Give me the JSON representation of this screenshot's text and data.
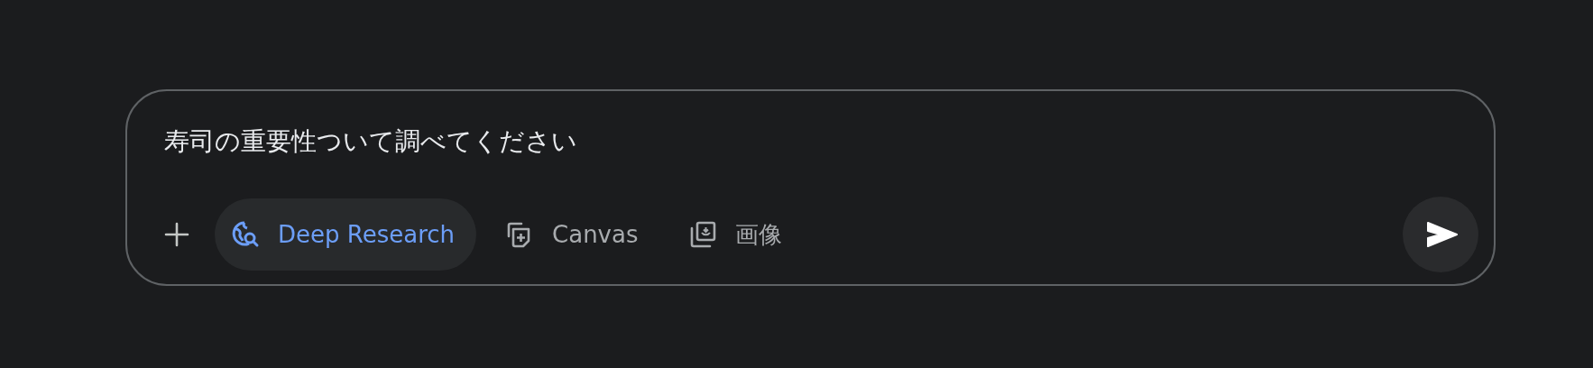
{
  "prompt": {
    "value": "寿司の重要性ついて調べてください"
  },
  "tools": [
    {
      "kind": "deep-research",
      "label": "Deep Research",
      "selected": true
    },
    {
      "kind": "canvas",
      "label": "Canvas",
      "selected": false
    },
    {
      "kind": "image",
      "label": "画像",
      "selected": false
    }
  ]
}
